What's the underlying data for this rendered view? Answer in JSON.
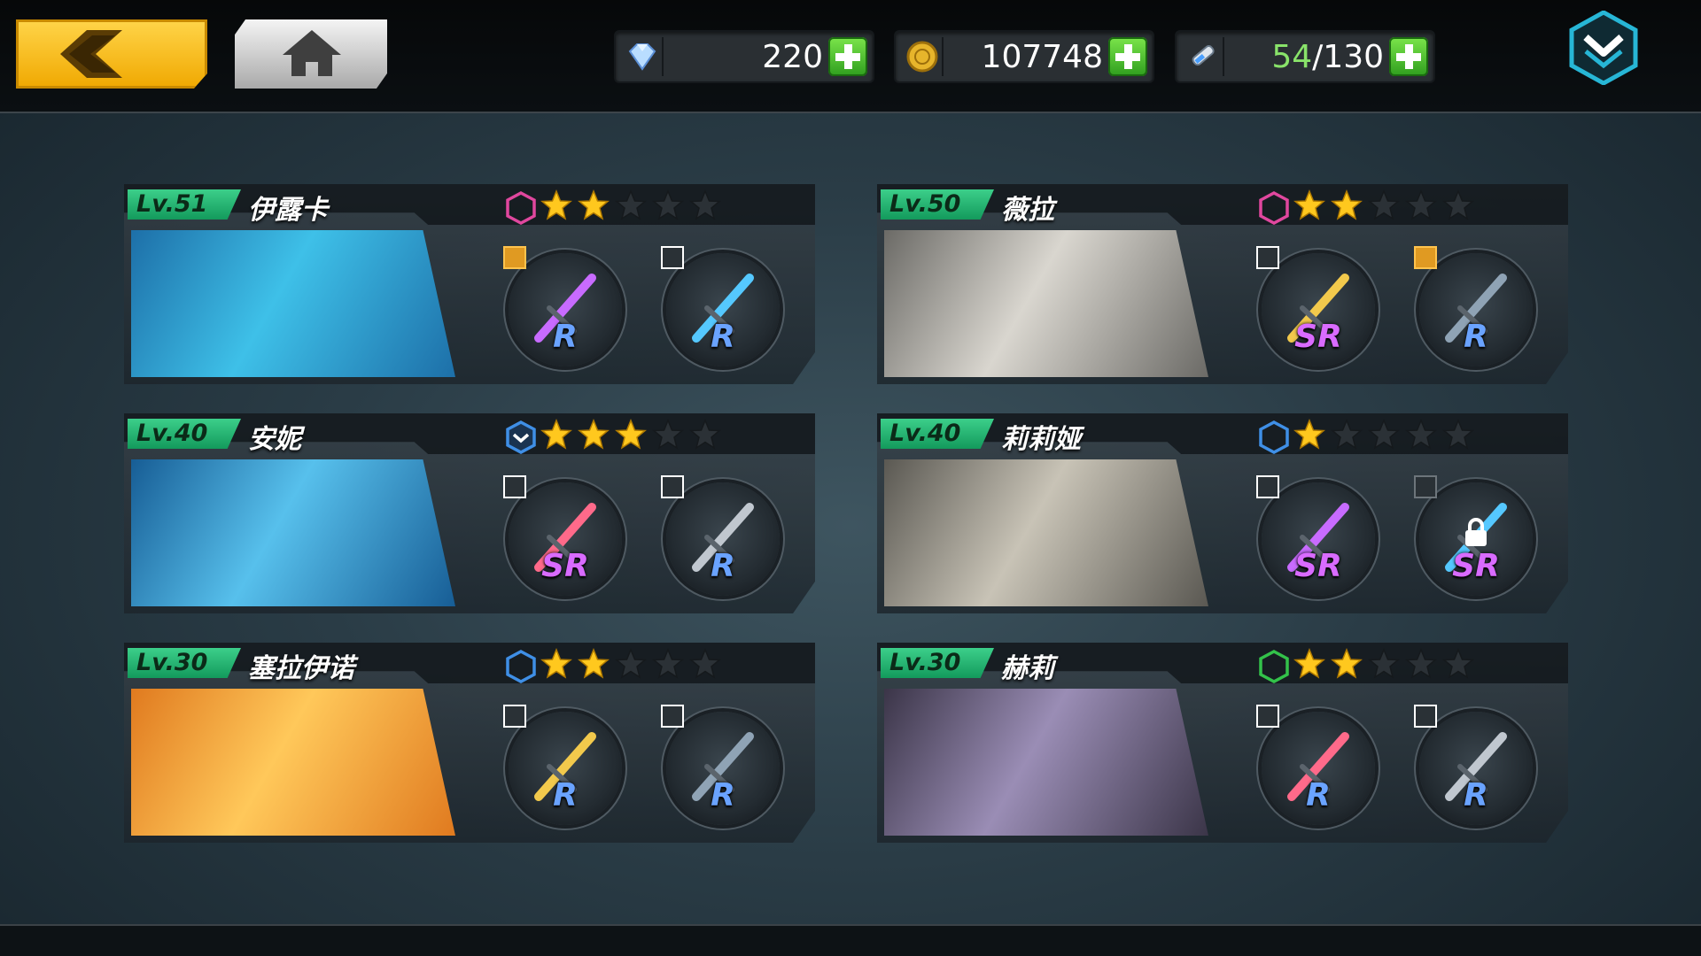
{
  "topbar": {
    "gems": "220",
    "coins": "107748",
    "stamina_current": "54",
    "stamina_max": "/130"
  },
  "colors": {
    "accent_yellow": "#f0a800",
    "level_green": "#1fb56f",
    "rarity_R": "#6aa3ff",
    "rarity_SR": "#d96bff",
    "star_gold": "#ffc81e",
    "plus_green": "#3db62a"
  },
  "characters": [
    {
      "level": "Lv.51",
      "name": "伊露卡",
      "class_color": "#e0479e",
      "class_icon": "hexagon-pink-icon",
      "stars": 2,
      "max_stars": 5,
      "portrait_colors": [
        "#1d6fa8",
        "#3ec0e8"
      ],
      "weapons": [
        {
          "rank": "R",
          "tag": "gold",
          "icon": "twin-swords-icon",
          "locked": false
        },
        {
          "rank": "R",
          "tag": "white",
          "icon": "twin-blades-icon",
          "locked": false
        }
      ]
    },
    {
      "level": "Lv.50",
      "name": "薇拉",
      "class_color": "#e0479e",
      "class_icon": "hexagon-pink-icon",
      "stars": 2,
      "max_stars": 5,
      "portrait_colors": [
        "#6b6a66",
        "#d9d6cf"
      ],
      "weapons": [
        {
          "rank": "SR",
          "tag": "white",
          "icon": "death-canister-icon",
          "locked": false
        },
        {
          "rank": "R",
          "tag": "gold",
          "icon": "cannon-gauntlet-icon",
          "locked": false
        }
      ]
    },
    {
      "level": "Lv.40",
      "name": "安妮",
      "class_color": "#3f8fe6",
      "class_icon": "hexagon-chevron-blue-icon",
      "stars": 3,
      "max_stars": 5,
      "portrait_colors": [
        "#175d95",
        "#57c0ec"
      ],
      "weapons": [
        {
          "rank": "SR",
          "tag": "white",
          "icon": "bear-blaster-icon",
          "locked": false
        },
        {
          "rank": "R",
          "tag": "white",
          "icon": "cat-staff-icon",
          "locked": false
        }
      ]
    },
    {
      "level": "Lv.40",
      "name": "莉莉娅",
      "class_color": "#3f8fe6",
      "class_icon": "hexagon-blue-icon",
      "stars": 1,
      "max_stars": 5,
      "portrait_colors": [
        "#5a5852",
        "#c8c3b6"
      ],
      "weapons": [
        {
          "rank": "SR",
          "tag": "white",
          "icon": "power-fist-icon",
          "locked": false
        },
        {
          "rank": "SR",
          "tag": "dim",
          "icon": "skull-gauntlet-icon",
          "locked": true
        }
      ]
    },
    {
      "level": "Lv.30",
      "name": "塞拉伊诺",
      "class_color": "#3f8fe6",
      "class_icon": "hexagon-blue-icon",
      "stars": 2,
      "max_stars": 5,
      "portrait_colors": [
        "#e07a1f",
        "#ffc85a"
      ],
      "weapons": [
        {
          "rank": "R",
          "tag": "white",
          "icon": "golden-sword-icon",
          "locked": false
        },
        {
          "rank": "R",
          "tag": "white",
          "icon": "ribbon-blade-icon",
          "locked": false
        }
      ]
    },
    {
      "level": "Lv.30",
      "name": "赫莉",
      "class_color": "#33c24a",
      "class_icon": "hexagon-green-icon",
      "stars": 2,
      "max_stars": 5,
      "portrait_colors": [
        "#3b3548",
        "#9a8db5"
      ],
      "weapons": [
        {
          "rank": "R",
          "tag": "white",
          "icon": "rifle-icon",
          "locked": false
        },
        {
          "rank": "R",
          "tag": "white",
          "icon": "chainsaw-icon",
          "locked": false
        }
      ]
    }
  ]
}
